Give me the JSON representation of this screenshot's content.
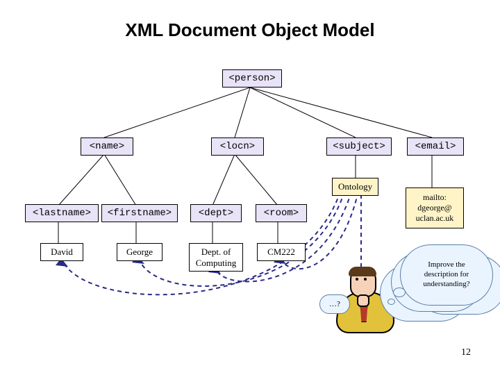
{
  "title": "XML Document Object Model",
  "pageNumber": "12",
  "tree": {
    "root": "<person>",
    "level2": {
      "name": "<name>",
      "locn": "<locn>",
      "subject": "<subject>",
      "email": "<email>"
    },
    "level3": {
      "lastname": "<lastname>",
      "firstname": "<firstname>",
      "dept": "<dept>",
      "room": "<room>"
    },
    "leaves": {
      "lastname_val": "David",
      "firstname_val": "George",
      "dept_val_l1": "Dept. of",
      "dept_val_l2": "Computing",
      "room_val": "CM222"
    }
  },
  "ontology": {
    "label": "Ontology",
    "email_l1": "mailto:",
    "email_l2": "dgeorge@",
    "email_l3": "uclan.ac.uk"
  },
  "thoughts": {
    "big_l1": "Improve the",
    "big_l2": "description for",
    "big_l3": "understanding?",
    "small": "…?"
  }
}
